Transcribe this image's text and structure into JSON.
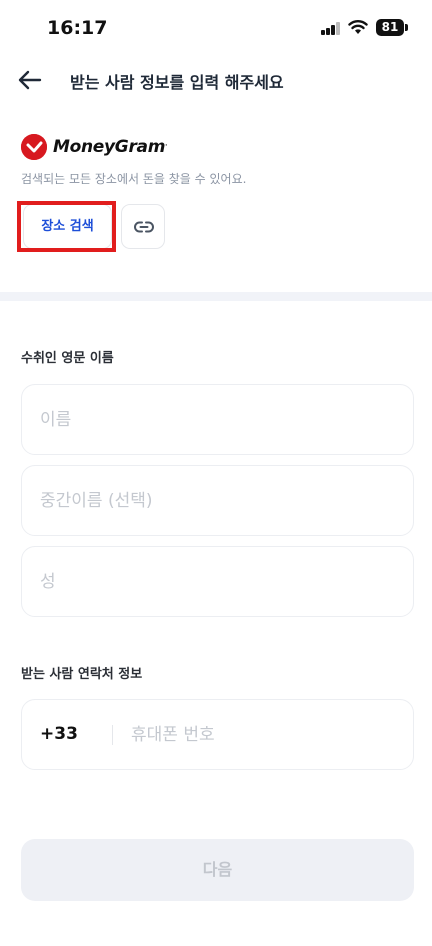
{
  "status_bar": {
    "time": "16:17",
    "battery": "81"
  },
  "header": {
    "title": "받는 사람 정보를 입력 해주세요",
    "back_icon": "arrow-left-icon"
  },
  "provider": {
    "name": "MoneyGram",
    "trademark": ".",
    "description": "검색되는 모든 장소에서 돈을 찾을 수 있어요.",
    "brand_color": "#d71920",
    "search_button_label": "장소 검색",
    "link_icon": "link-icon"
  },
  "recipient_name": {
    "section_label": "수취인 영문 이름",
    "first_name_placeholder": "이름",
    "middle_name_placeholder": "중간이름 (선택)",
    "last_name_placeholder": "성"
  },
  "recipient_contact": {
    "section_label": "받는 사람 연락처 정보",
    "country_code": "+33",
    "phone_placeholder": "휴대폰 번호"
  },
  "footer": {
    "next_label": "다음"
  },
  "colors": {
    "accent": "#1d4ed8",
    "highlight": "#e11d1d",
    "disabled_bg": "#eef0f5"
  }
}
